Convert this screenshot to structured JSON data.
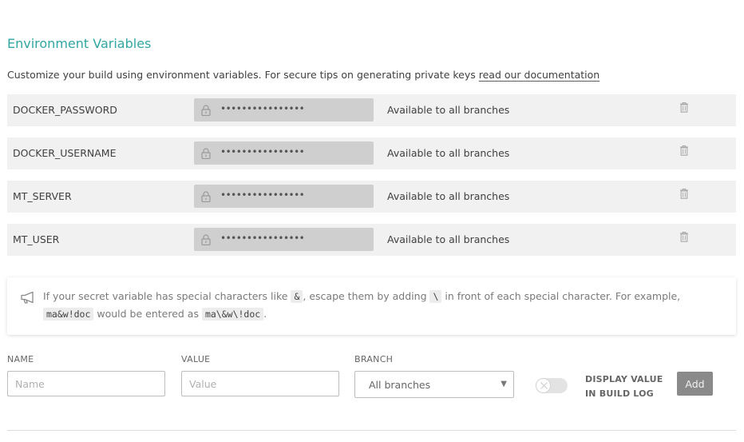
{
  "section": {
    "title": "Environment Variables",
    "subtitle": "Customize your build using environment variables. For secure tips on generating private keys ",
    "doc_link": "read our documentation"
  },
  "variables": [
    {
      "name": "DOCKER_PASSWORD",
      "value_mask": "••••••••••••••••",
      "branch": "Available to all branches"
    },
    {
      "name": "DOCKER_USERNAME",
      "value_mask": "••••••••••••••••",
      "branch": "Available to all branches"
    },
    {
      "name": "MT_SERVER",
      "value_mask": "••••••••••••••••",
      "branch": "Available to all branches"
    },
    {
      "name": "MT_USER",
      "value_mask": "••••••••••••••••",
      "branch": "Available to all branches"
    }
  ],
  "notice": {
    "icon": "megaphone-icon",
    "t1": "If your secret variable has special characters like ",
    "c1": "&",
    "t2": ", escape them by adding ",
    "c2": "\\",
    "t3": " in front of each special character. For example, ",
    "c3": "ma&w!doc",
    "t4": " would be entered as ",
    "c4": "ma\\&w\\!doc",
    "t5": "."
  },
  "form": {
    "name_label": "NAME",
    "name_placeholder": "Name",
    "value_label": "VALUE",
    "value_placeholder": "Value",
    "branch_label": "BRANCH",
    "branch_value": "All branches",
    "display_line1": "DISPLAY VALUE",
    "display_line2": "IN BUILD LOG",
    "display_toggle_on": false,
    "add_label": "Add"
  },
  "colors": {
    "accent": "#32a6a0",
    "row_bg": "#f1f1f1",
    "masked_bg": "#cfcfcf",
    "button_bg": "#8a8a8a"
  }
}
